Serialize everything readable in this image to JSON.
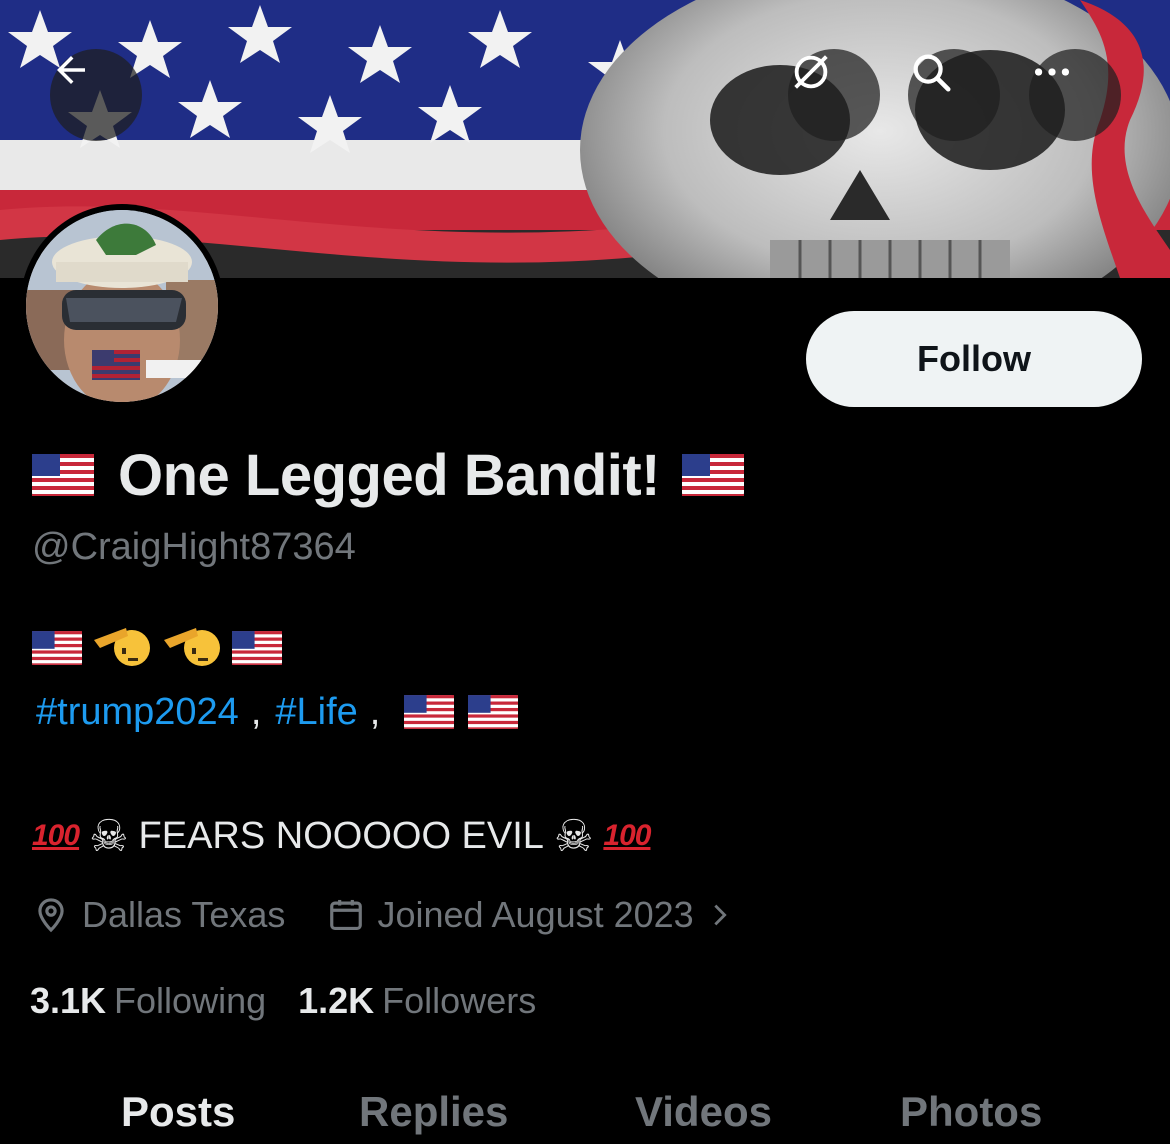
{
  "header": {
    "back_icon": "arrow-left-icon",
    "grok_icon": "grok-icon",
    "search_icon": "search-icon",
    "more_icon": "more-horizontal-icon"
  },
  "profile": {
    "display_name": "One Legged Bandit!",
    "handle": "@CraigHight87364",
    "follow_label": "Follow",
    "bio": {
      "hashtags": [
        "#trump2024",
        "#Life"
      ],
      "separator": ",",
      "hundred": "100",
      "skull": "☠",
      "motto": "FEARS NOOOOO EVIL"
    },
    "location": "Dallas Texas",
    "joined": "Joined August 2023",
    "stats": {
      "following_count": "3.1K",
      "following_label": "Following",
      "followers_count": "1.2K",
      "followers_label": "Followers"
    }
  },
  "tabs": [
    {
      "label": "Posts",
      "active": true
    },
    {
      "label": "Replies",
      "active": false
    },
    {
      "label": "Videos",
      "active": false
    },
    {
      "label": "Photos",
      "active": false
    }
  ],
  "colors": {
    "background": "#000000",
    "text_primary": "#e7e9ea",
    "text_secondary": "#71767b",
    "link": "#1d9bf0",
    "follow_button": "#eff3f4"
  }
}
